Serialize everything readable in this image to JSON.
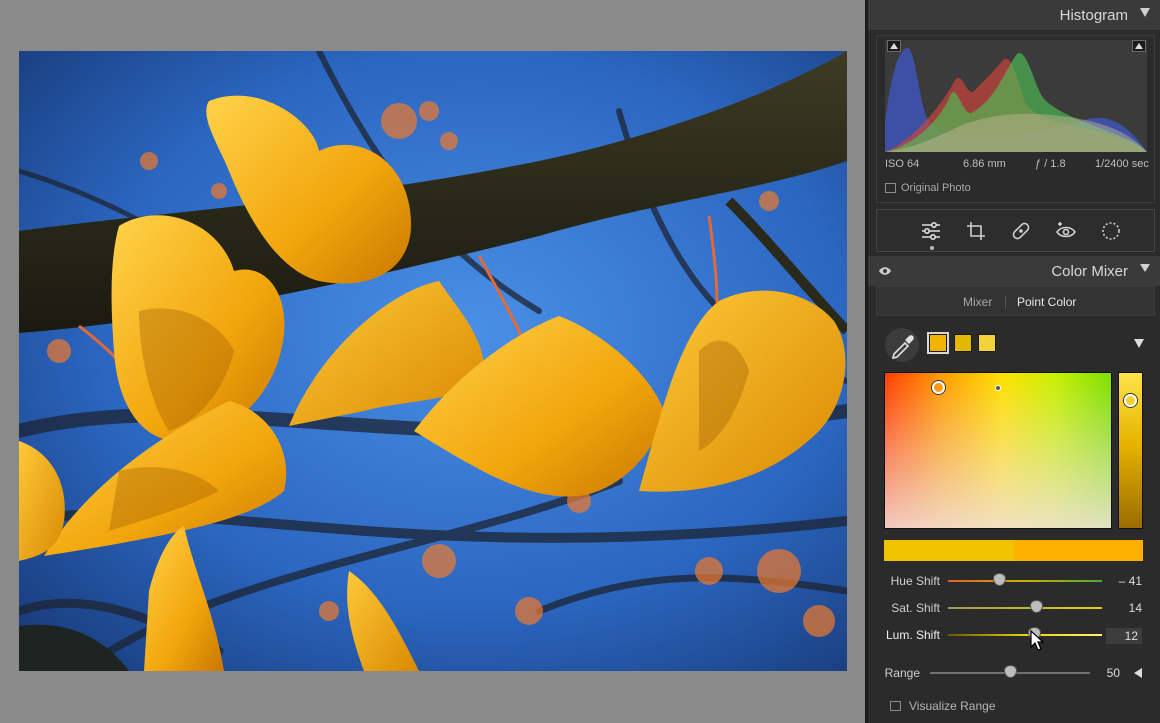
{
  "histogram": {
    "title": "Histogram",
    "iso": "ISO 64",
    "focal": "6.86 mm",
    "aperture": "ƒ / 1.8",
    "shutter": "1/2400 sec",
    "original_photo": "Original Photo"
  },
  "toolstrip": {
    "tools": [
      "edit-sliders-icon",
      "crop-icon",
      "healing-icon",
      "redeye-icon",
      "masking-icon"
    ],
    "active": "edit-sliders-icon"
  },
  "color_mixer": {
    "title": "Color Mixer",
    "tabs": [
      "Mixer",
      "Point Color"
    ],
    "active_tab": "Point Color",
    "swatches": [
      "#f2b400",
      "#e3b800",
      "#f5d13a"
    ],
    "sliders": [
      {
        "label": "Hue Shift",
        "value": "– 41",
        "level": 0.33
      },
      {
        "label": "Sat. Shift",
        "value": "14",
        "level": 0.57
      },
      {
        "label": "Lum. Shift",
        "value": "12",
        "level": 0.56
      }
    ],
    "range": {
      "label": "Range",
      "value": "50",
      "level": 0.5
    },
    "visualize_range": "Visualize Range",
    "compare_colors": [
      "#f0c300",
      "#ffb000"
    ]
  }
}
